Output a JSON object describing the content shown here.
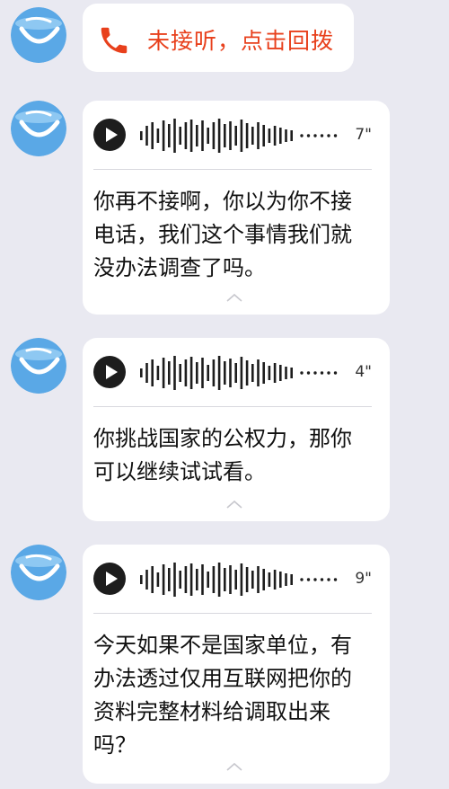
{
  "missed_call": {
    "text": "未接听，点击回拨",
    "icon": "phone-icon",
    "color": "#e8401c"
  },
  "voice_messages": [
    {
      "duration": "7\"",
      "transcript": "你再不接啊，你以为你不接电话，我们这个事情我们就没办法调查了吗。"
    },
    {
      "duration": "4\"",
      "transcript": "你挑战国家的公权力，那你可以继续试试看。"
    },
    {
      "duration": "9\"",
      "transcript": "今天如果不是国家单位，有办法透过仅用互联网把你的资料完整材料给调取出来吗？"
    }
  ]
}
